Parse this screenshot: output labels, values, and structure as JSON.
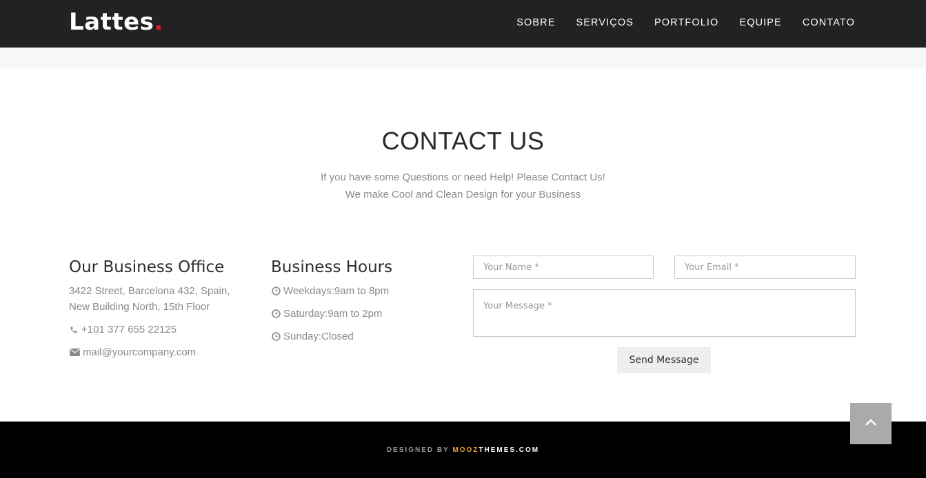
{
  "header": {
    "logo_text": "Lattes",
    "logo_dot": ".",
    "nav": [
      "SOBRE",
      "SERVIÇOS",
      "PORTFOLIO",
      "EQUIPE",
      "CONTATO"
    ]
  },
  "contact": {
    "title": "CONTACT US",
    "subtitle_line1": "If you have some Questions or need Help! Please Contact Us!",
    "subtitle_line2": "We make Cool and Clean Design for your Business"
  },
  "office": {
    "title": "Our Business Office",
    "address_line1": "3422 Street, Barcelona 432, Spain,",
    "address_line2": "New Building North, 15th Floor",
    "phone": "+101 377 655 22125",
    "email": "mail@yourcompany.com",
    "phone_icon": "phone-icon",
    "email_icon": "envelope-icon"
  },
  "hours": {
    "title": "Business Hours",
    "items": [
      "Weekdays:9am to 8pm",
      "Saturday:9am to 2pm",
      "Sunday:Closed"
    ],
    "icon": "clock-icon"
  },
  "form": {
    "name_placeholder": "Your Name *",
    "email_placeholder": "Your Email *",
    "message_placeholder": "Your Message *",
    "send_label": "Send Message"
  },
  "footer": {
    "credit_prefix": "DESIGNED BY ",
    "brand_part1": "MOOZ",
    "brand_part2": "THEMES.COM"
  },
  "colors": {
    "header_bg": "#222222",
    "accent_red": "#e01c24",
    "brand_orange": "#f39c34",
    "footer_bg": "#000000"
  }
}
